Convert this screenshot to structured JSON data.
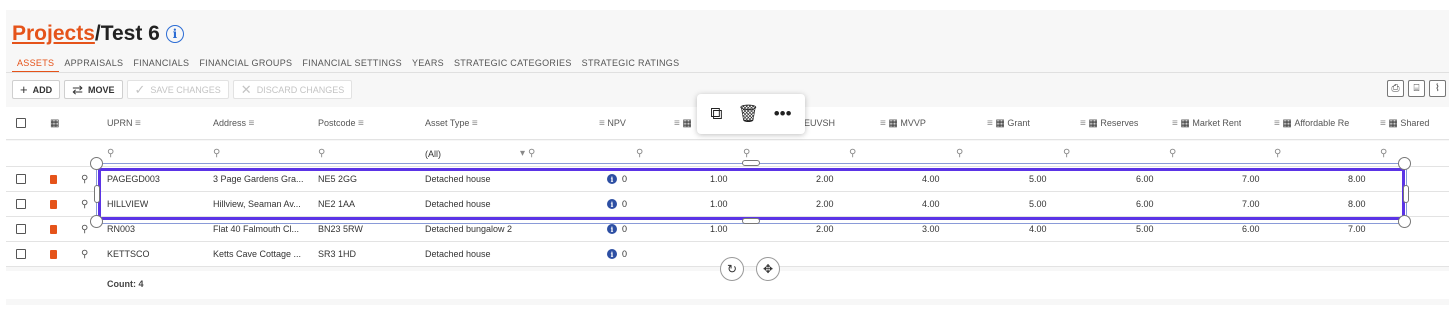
{
  "breadcrumb": {
    "parent": "Projects",
    "separator": "/",
    "current": "Test 6",
    "info_icon": "info-icon"
  },
  "tabs": [
    {
      "label": "ASSETS",
      "active": true
    },
    {
      "label": "APPRAISALS"
    },
    {
      "label": "FINANCIALS"
    },
    {
      "label": "FINANCIAL GROUPS"
    },
    {
      "label": "FINANCIAL SETTINGS"
    },
    {
      "label": "YEARS"
    },
    {
      "label": "STRATEGIC CATEGORIES"
    },
    {
      "label": "STRATEGIC RATINGS"
    }
  ],
  "toolbar": {
    "add_label": "ADD",
    "move_label": "MOVE",
    "save_label": "SAVE CHANGES",
    "discard_label": "DISCARD CHANGES"
  },
  "columns": {
    "uprn": "UPRN",
    "address": "Address",
    "postcode": "Postcode",
    "asset_type": "Asset Type",
    "npv": "NPV",
    "euvsh": "EUVSH",
    "mvvp": "MVVP",
    "grant": "Grant",
    "reserves": "Reserves",
    "market_rent": "Market Rent",
    "affordable": "Affordable Re",
    "shared": "Shared"
  },
  "filter": {
    "asset_type_value": "(All)"
  },
  "rows": [
    {
      "uprn": "PAGEGD003",
      "address": "3 Page Gardens Gra...",
      "postcode": "NE5 2GG",
      "asset_type": "Detached house",
      "npv": "0",
      "c1": "1.00",
      "euvsh": "2.00",
      "mvvp": "4.00",
      "grant": "5.00",
      "reserves": "6.00",
      "market_rent": "7.00",
      "affordable": "8.00"
    },
    {
      "uprn": "HILLVIEW",
      "address": "Hillview, Seaman Av...",
      "postcode": "NE2 1AA",
      "asset_type": "Detached house",
      "npv": "0",
      "c1": "1.00",
      "euvsh": "2.00",
      "mvvp": "4.00",
      "grant": "5.00",
      "reserves": "6.00",
      "market_rent": "7.00",
      "affordable": "8.00"
    },
    {
      "uprn": "RN003",
      "address": "Flat 40 Falmouth Cl...",
      "postcode": "BN23 5RW",
      "asset_type": "Detached bungalow 2",
      "npv": "0",
      "c1": "1.00",
      "euvsh": "2.00",
      "mvvp": "3.00",
      "grant": "4.00",
      "reserves": "5.00",
      "market_rent": "6.00",
      "affordable": "7.00"
    },
    {
      "uprn": "KETTSCO",
      "address": "Ketts Cave Cottage ...",
      "postcode": "SR3 1HD",
      "asset_type": "Detached house",
      "npv": "0",
      "c1": "",
      "euvsh": "",
      "mvvp": "",
      "grant": "",
      "reserves": "",
      "market_rent": "",
      "affordable": ""
    }
  ],
  "footer": {
    "count": "Count: 4"
  },
  "colors": {
    "accent": "#e5531a",
    "selection": "#5b34e6",
    "info": "#2d4fa3"
  }
}
